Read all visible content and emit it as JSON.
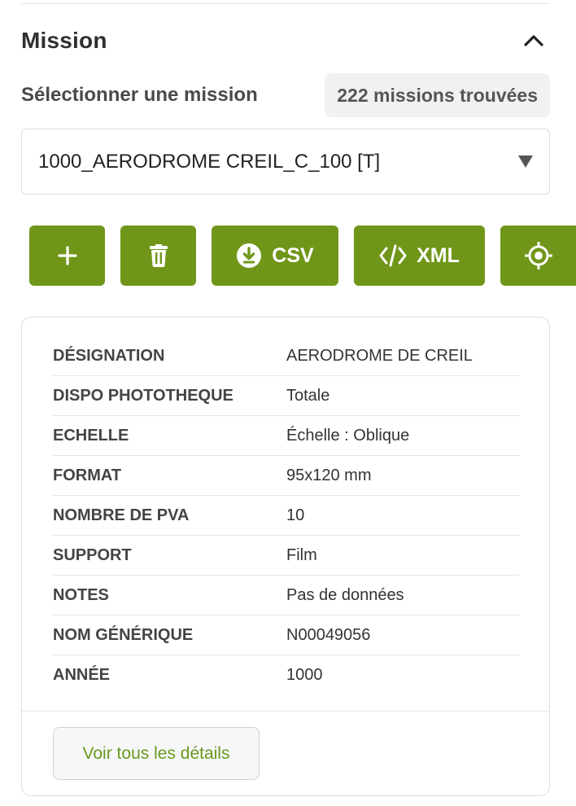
{
  "section": {
    "title": "Mission"
  },
  "selector": {
    "label": "Sélectionner une mission",
    "count_badge": "222 missions trouvées",
    "selected_value": "1000_AERODROME CREIL_C_100 [T]"
  },
  "toolbar": {
    "add_icon": "plus-icon",
    "delete_icon": "trash-icon",
    "csv_label": "CSV",
    "csv_icon": "download-circle-icon",
    "xml_label": "XML",
    "xml_icon": "code-icon",
    "locate_icon": "crosshair-icon",
    "button_color": "#709619"
  },
  "details": {
    "rows": [
      {
        "key": "DÉSIGNATION",
        "value": "AERODROME DE CREIL"
      },
      {
        "key": "DISPO PHOTOTHEQUE",
        "value": "Totale"
      },
      {
        "key": "ECHELLE",
        "value": "Échelle : Oblique"
      },
      {
        "key": "FORMAT",
        "value": "95x120 mm"
      },
      {
        "key": "NOMBRE DE PVA",
        "value": "10"
      },
      {
        "key": "SUPPORT",
        "value": "Film"
      },
      {
        "key": "NOTES",
        "value": "Pas de données"
      },
      {
        "key": "NOM GÉNÉRIQUE",
        "value": "N00049056"
      },
      {
        "key": "ANNÉE",
        "value": "1000"
      }
    ],
    "view_all_label": "Voir tous les détails",
    "link_color": "#6a9a1c"
  }
}
